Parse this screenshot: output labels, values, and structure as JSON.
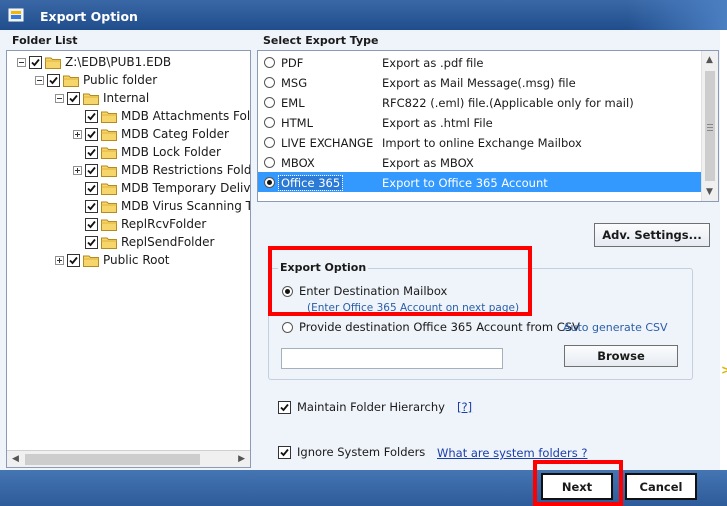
{
  "window": {
    "title": "Export Option"
  },
  "folder_list": {
    "label": "Folder List",
    "items": [
      {
        "label": "Z:\\EDB\\PUB1.EDB",
        "level": 0,
        "expander": "minus",
        "checked": true
      },
      {
        "label": "Public folder",
        "level": 1,
        "expander": "minus",
        "checked": true
      },
      {
        "label": "Internal",
        "level": 2,
        "expander": "minus",
        "checked": true
      },
      {
        "label": "MDB Attachments Folder",
        "level": 3,
        "expander": "none",
        "checked": true
      },
      {
        "label": "MDB Categ Folder",
        "level": 3,
        "expander": "plus",
        "checked": true
      },
      {
        "label": "MDB Lock Folder",
        "level": 3,
        "expander": "none",
        "checked": true
      },
      {
        "label": "MDB Restrictions Folder",
        "level": 3,
        "expander": "plus",
        "checked": true
      },
      {
        "label": "MDB Temporary Delivery",
        "level": 3,
        "expander": "none",
        "checked": true
      },
      {
        "label": "MDB Virus Scanning Temp",
        "level": 3,
        "expander": "none",
        "checked": true
      },
      {
        "label": "ReplRcvFolder",
        "level": 3,
        "expander": "none",
        "checked": true
      },
      {
        "label": "ReplSendFolder",
        "level": 3,
        "expander": "none",
        "checked": true
      },
      {
        "label": "Public Root",
        "level": 2,
        "expander": "plus",
        "checked": true
      }
    ]
  },
  "export_type": {
    "label": "Select Export Type",
    "options": [
      {
        "name": "PDF",
        "description": "Export as .pdf file",
        "selected": false
      },
      {
        "name": "MSG",
        "description": "Export as Mail Message(.msg) file",
        "selected": false
      },
      {
        "name": "EML",
        "description": "RFC822 (.eml) file.(Applicable only for mail)",
        "selected": false
      },
      {
        "name": "HTML",
        "description": "Export as .html File",
        "selected": false
      },
      {
        "name": "LIVE EXCHANGE",
        "description": "Import to online Exchange Mailbox",
        "selected": false
      },
      {
        "name": "MBOX",
        "description": "Export as MBOX",
        "selected": false
      },
      {
        "name": "Office 365",
        "description": "Export to Office 365 Account",
        "selected": true
      }
    ]
  },
  "adv_settings_label": "Adv. Settings...",
  "export_option": {
    "label": "Export Option",
    "enter_mailbox_label": "Enter Destination Mailbox",
    "enter_mailbox_hint": "(Enter Office 365 Account on next page)",
    "provide_csv_label": "Provide destination Office 365 Account from CSV",
    "auto_generate_label": "Auto generate CSV",
    "csv_path_value": "",
    "browse_label": "Browse"
  },
  "maintain_hierarchy": {
    "label": "Maintain Folder Hierarchy",
    "checked": true,
    "help_link": "[?]"
  },
  "ignore_system": {
    "label": "Ignore System Folders",
    "checked": true,
    "link": "What are system folders ?"
  },
  "footer": {
    "next_label": "Next",
    "cancel_label": "Cancel"
  },
  "colors": {
    "selection": "#3399ff",
    "title_bar": "#2b5797",
    "highlight_box": "#ff0000"
  }
}
